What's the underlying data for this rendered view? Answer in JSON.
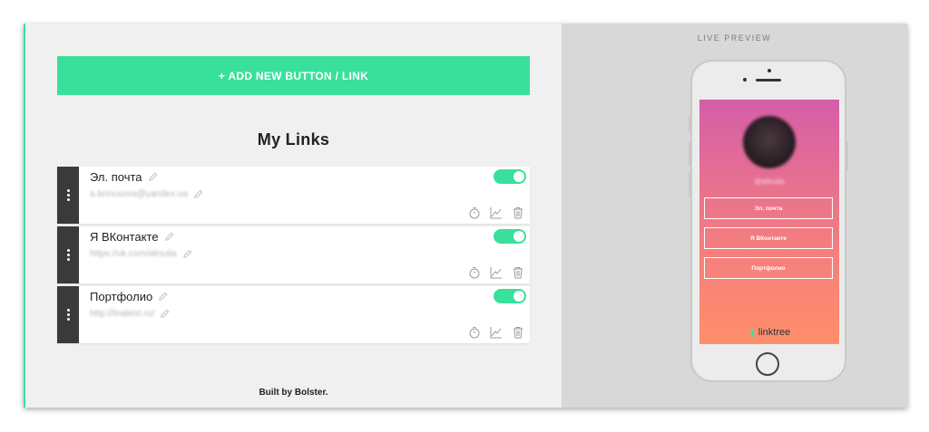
{
  "editor": {
    "add_button_label": "+ ADD NEW BUTTON / LINK",
    "heading": "My Links",
    "footer": "Built by Bolster."
  },
  "links": [
    {
      "title": "Эл. почта",
      "url": "a.brinusova@yandex.ua",
      "enabled": true
    },
    {
      "title": "Я ВКонтакте",
      "url": "https://vk.com/alinulia",
      "enabled": true
    },
    {
      "title": "Портфолио",
      "url": "http://linatest.ru/",
      "enabled": true
    }
  ],
  "preview": {
    "label": "LIVE PREVIEW",
    "username": "@alinulia",
    "buttons": [
      "Эл. почта",
      "Я ВКонтакте",
      "Портфолио"
    ],
    "brand": "linktree"
  },
  "icons": {
    "drag": "drag-handle-icon",
    "edit": "pencil-icon",
    "schedule": "stopwatch-icon",
    "analytics": "chart-icon",
    "delete": "trash-icon",
    "brand": "linktree-leaf-icon"
  },
  "colors": {
    "accent": "#39e09b",
    "handle": "#3a3a3a",
    "gradient_top": "#d45ea8",
    "gradient_bottom": "#ff8f6a"
  }
}
